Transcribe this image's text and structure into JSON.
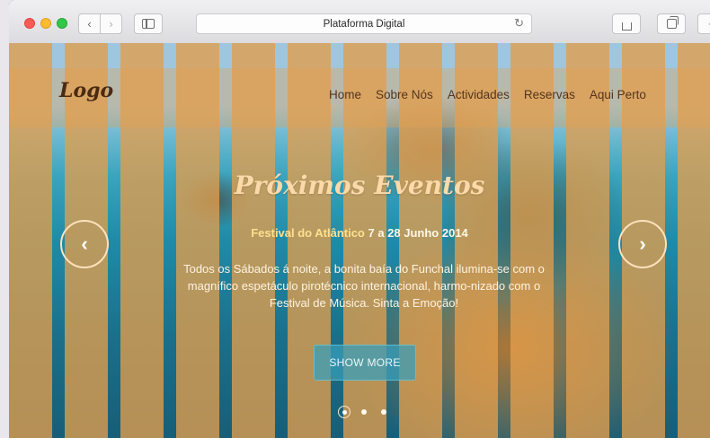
{
  "browser": {
    "address_title": "Plataforma Digital",
    "back_glyph": "‹",
    "forward_glyph": "›",
    "reload_glyph": "↻",
    "plus_glyph": "+",
    "icons": [
      "close-icon",
      "minimize-icon",
      "maximize-icon",
      "chevron-left-icon",
      "chevron-right-icon",
      "sidebar-icon",
      "reload-icon",
      "share-icon",
      "tabs-icon",
      "plus-icon"
    ]
  },
  "site": {
    "logo": "Logo",
    "nav": [
      "Home",
      "Sobre Nós",
      "Actividades",
      "Reservas",
      "Aqui Perto"
    ],
    "headline": "Próximos Eventos",
    "event_name": "Festival do Atlântico",
    "event_dates": "7 a 28 Junho 2014",
    "description": "Todos os Sábados á noite, a bonita baía do Funchal ilumina-se com o magnífico espetáculo pirotécnico internacional, harmo-nizado com o Festival de Música. Sinta a Emoção!",
    "cta": "SHOW MORE",
    "prev_glyph": "‹",
    "next_glyph": "›",
    "slide_count": 3,
    "active_slide": 1
  },
  "colors": {
    "accent_orange": "#e29e4c",
    "button_teal": "#389eba",
    "headline": "#fbd9a9"
  }
}
